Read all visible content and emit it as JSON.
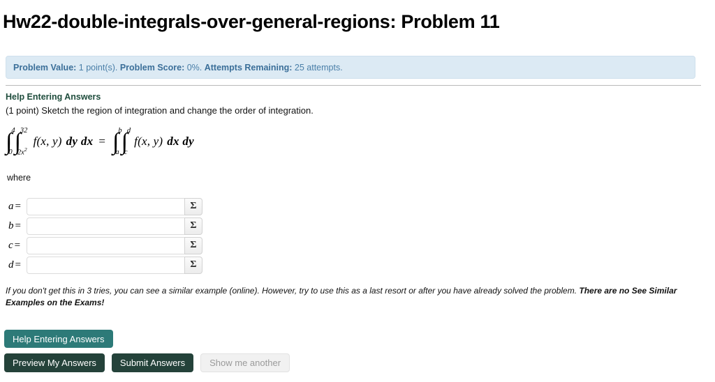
{
  "header": {
    "title": "Hw22-double-integrals-over-general-regions: Problem 11"
  },
  "info_bar": {
    "problem_value_label": "Problem Value:",
    "problem_value": " 1 point(s). ",
    "problem_score_label": "Problem Score:",
    "problem_score": " 0%. ",
    "attempts_label": "Attempts Remaining:",
    "attempts_value": " 25 attempts.",
    "background_color": "#dceaf4",
    "text_color": "#4a7fa8"
  },
  "help_link": {
    "label": "Help Entering Answers"
  },
  "prompt": {
    "text": "(1 point) Sketch the region of integration and change the order of integration."
  },
  "math": {
    "left_outer_upper": "4",
    "left_outer_lower": "0",
    "left_inner_upper": "32",
    "left_inner_lower_base": "2x",
    "left_inner_lower_exp": "2",
    "left_integrand": "f(x, y)",
    "left_differentials": "dy dx",
    "equals": "=",
    "right_outer_upper": "b",
    "right_outer_lower": "a",
    "right_inner_upper": "d",
    "right_inner_lower": "c",
    "right_integrand": "f(x, y)",
    "right_differentials": "dx dy"
  },
  "where_label": "where",
  "answers": {
    "sigma_symbol": "Σ",
    "rows": [
      {
        "label": "a",
        "equals": "=",
        "value": "",
        "placeholder": ""
      },
      {
        "label": "b",
        "equals": "=",
        "value": "",
        "placeholder": ""
      },
      {
        "label": "c",
        "equals": "=",
        "value": "",
        "placeholder": ""
      },
      {
        "label": "d",
        "equals": "=",
        "value": "",
        "placeholder": ""
      }
    ]
  },
  "footnote": {
    "normal_text": "If you don't get this in 3 tries, you can see a similar example (online). However, try to use this as a last resort or after you have already solved the problem. ",
    "bold_text": "There are no See Similar Examples on the Exams!"
  },
  "buttons": {
    "help_entering_answers": "Help Entering Answers",
    "preview_my_answers": "Preview My Answers",
    "submit_answers": "Submit Answers",
    "show_me_another": "Show me another",
    "teal_color": "#2d7a78",
    "dark_green_color": "#24423a",
    "disabled_color": "#f1f1f1"
  }
}
